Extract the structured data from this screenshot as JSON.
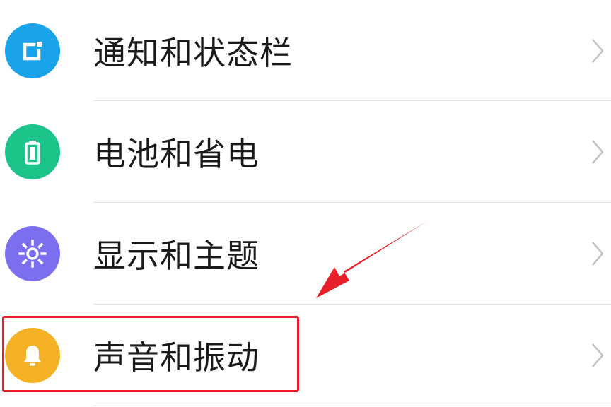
{
  "settings": {
    "items": [
      {
        "label": "通知和状态栏",
        "icon": "notification-icon",
        "color": "#1aa3e8"
      },
      {
        "label": "电池和省电",
        "icon": "battery-icon",
        "color": "#1cc48a"
      },
      {
        "label": "显示和主题",
        "icon": "brightness-icon",
        "color": "#7b6ff0"
      },
      {
        "label": "声音和振动",
        "icon": "bell-icon",
        "color": "#f5b227"
      }
    ]
  },
  "annotation": {
    "highlight_color": "#e8202a",
    "arrow_color": "#e8202a"
  }
}
